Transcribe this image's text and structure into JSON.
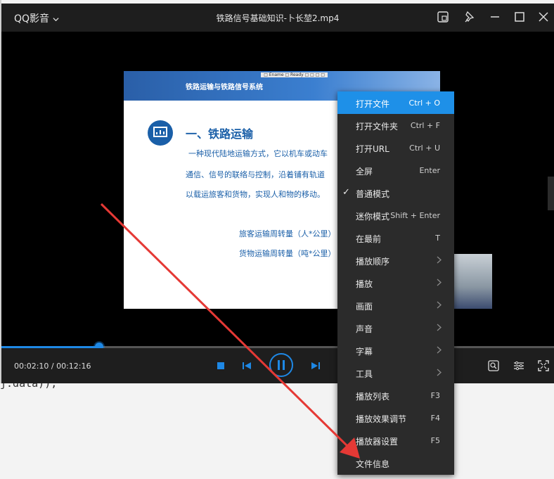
{
  "background": {
    "code_text": "j.data));"
  },
  "titlebar": {
    "app_name": "QQ影音",
    "file_title": "铁路信号基础知识-卜长堃2.mp4"
  },
  "slide": {
    "toolbar_text": "□ Ename □ Ready □ □ □ □",
    "banner_title": "铁路运输与铁路信号系统",
    "heading": "一、铁路运输",
    "line1": "一种现代陆地运输方式，它以机车或动车",
    "line2": "通信、信号的联络与控制，沿着铺有轨道",
    "line3": "以载运旅客和货物，实现人和物的移动。",
    "line4": "旅客运输周转量（人*公里）",
    "line5": "货物运输周转量（吨*公里）"
  },
  "playback": {
    "time": "00:02:10 / 00:12:16",
    "progress": 0.177
  },
  "menu": {
    "items": [
      {
        "label": "打开文件",
        "shortcut": "Ctrl + O"
      },
      {
        "label": "打开文件夹",
        "shortcut": "Ctrl + F"
      },
      {
        "label": "打开URL",
        "shortcut": "Ctrl + U"
      },
      {
        "label": "全屏",
        "shortcut": "Enter"
      },
      {
        "label": "普通模式",
        "shortcut": ""
      },
      {
        "label": "迷你模式",
        "shortcut": "Shift + Enter"
      },
      {
        "label": "在最前",
        "shortcut": "T"
      },
      {
        "label": "播放顺序",
        "shortcut": ""
      },
      {
        "label": "播放",
        "shortcut": ""
      },
      {
        "label": "画面",
        "shortcut": ""
      },
      {
        "label": "声音",
        "shortcut": ""
      },
      {
        "label": "字幕",
        "shortcut": ""
      },
      {
        "label": "工具",
        "shortcut": ""
      },
      {
        "label": "播放列表",
        "shortcut": "F3"
      },
      {
        "label": "播放效果调节",
        "shortcut": "F4"
      },
      {
        "label": "播放器设置",
        "shortcut": "F5"
      },
      {
        "label": "文件信息",
        "shortcut": ""
      }
    ],
    "checked_index": 4,
    "submenu_indices": [
      7,
      8,
      9,
      10,
      11,
      12
    ],
    "highlight_index": 0
  },
  "colors": {
    "accent": "#1e88e5",
    "menu_bg": "#2b2b2b",
    "annotation": "#e53935"
  }
}
